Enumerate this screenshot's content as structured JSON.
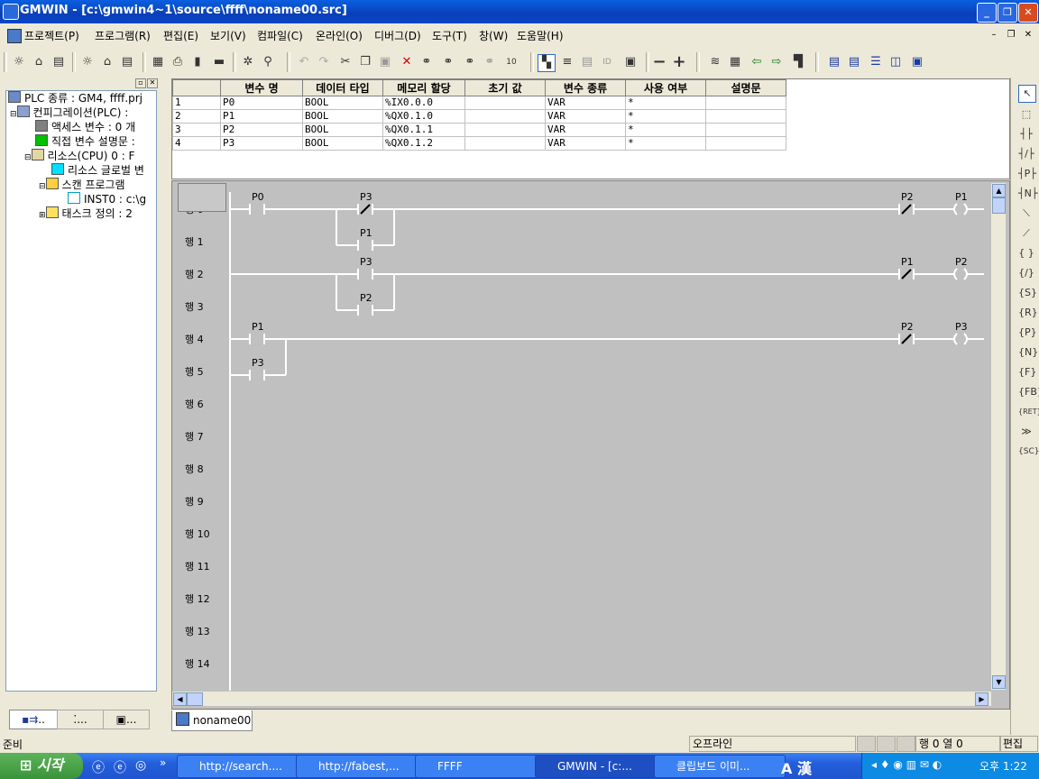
{
  "window": {
    "title": "GMWIN - [c:\\gmwin4~1\\source\\ffff\\noname00.src]"
  },
  "menu": [
    "프로젝트(P)",
    "프로그램(R)",
    "편집(E)",
    "보기(V)",
    "컴파일(C)",
    "온라인(O)",
    "디버그(D)",
    "도구(T)",
    "창(W)",
    "도움말(H)"
  ],
  "tree": {
    "items": [
      "PLC 종류 : GM4, ffff.prj",
      "컨피그레이션(PLC) :",
      "액세스 변수 : 0 개",
      "직접 변수 설명문 :",
      "리소스(CPU) 0 : F",
      "리소스 글로벌 변",
      "스캔 프로그램",
      "INST0 : c:\\g",
      "태스크 정의 : 2"
    ],
    "tabs": [
      "..",
      "...",
      "..."
    ]
  },
  "vartable": {
    "headers": [
      "변수 명",
      "데이터 타입",
      "메모리 할당",
      "초기 값",
      "변수 종류",
      "사용 여부",
      "설명문"
    ],
    "rows": [
      [
        "1",
        "P0",
        "BOOL",
        "%IX0.0.0",
        "",
        "VAR",
        "*",
        ""
      ],
      [
        "2",
        "P1",
        "BOOL",
        "%QX0.1.0",
        "",
        "VAR",
        "*",
        ""
      ],
      [
        "3",
        "P2",
        "BOOL",
        "%QX0.1.1",
        "",
        "VAR",
        "*",
        ""
      ],
      [
        "4",
        "P3",
        "BOOL",
        "%QX0.1.2",
        "",
        "VAR",
        "*",
        ""
      ]
    ]
  },
  "ladder": {
    "row_labels": [
      "행 0",
      "행 1",
      "행 2",
      "행 3",
      "행 4",
      "행 5",
      "행 6",
      "행 7",
      "행 8",
      "행 9",
      "행 10",
      "행 11",
      "행 12",
      "행 13",
      "행 14"
    ],
    "contacts": [
      {
        "row": 0,
        "label": "P0",
        "type": "NO"
      },
      {
        "row": 0,
        "label": "P3",
        "type": "NC"
      },
      {
        "row": 1,
        "label": "P1",
        "type": "NO"
      },
      {
        "row": 0,
        "label": "P2",
        "type": "NC"
      },
      {
        "row": 0,
        "label": "P1",
        "type": "coil"
      },
      {
        "row": 2,
        "label": "P3",
        "type": "NO"
      },
      {
        "row": 3,
        "label": "P2",
        "type": "NO"
      },
      {
        "row": 2,
        "label": "P1",
        "type": "NC"
      },
      {
        "row": 2,
        "label": "P2",
        "type": "coil"
      },
      {
        "row": 4,
        "label": "P1",
        "type": "NO"
      },
      {
        "row": 5,
        "label": "P3",
        "type": "NO"
      },
      {
        "row": 4,
        "label": "P2",
        "type": "NC"
      },
      {
        "row": 4,
        "label": "P3",
        "type": "coil"
      }
    ]
  },
  "doc_tab": "noname00",
  "status": {
    "left": "준비",
    "mode": "오프라인",
    "position": "행 0 열 0",
    "edit": "편집"
  },
  "taskbar": {
    "start": "시작",
    "tasks": [
      "http://search....",
      "http://fabest,...",
      "FFFF",
      "GMWIN - [c:...",
      "클립보드 이미..."
    ],
    "ime": "A 漢",
    "clock": "오후 1:22"
  }
}
